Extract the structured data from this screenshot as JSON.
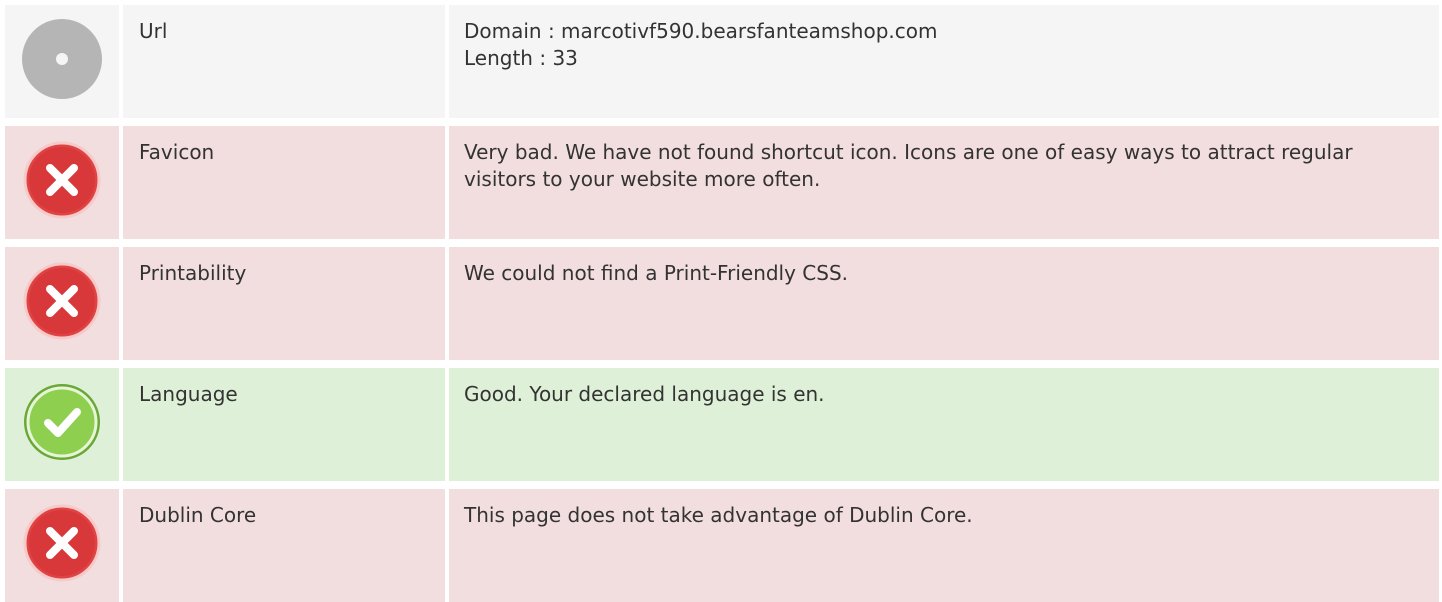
{
  "rows": [
    {
      "status": "neutral",
      "icon": "neutral-dot-icon",
      "label": "Url",
      "lines": [
        "Domain : marcotivf590.bearsfanteamshop.com",
        "Length : 33"
      ]
    },
    {
      "status": "bad",
      "icon": "error-x-icon",
      "label": "Favicon",
      "lines": [
        "Very bad. We have not found shortcut icon. Icons are one of easy ways to attract regular visitors to your website more often."
      ]
    },
    {
      "status": "bad",
      "icon": "error-x-icon",
      "label": "Printability",
      "lines": [
        "We could not find a Print-Friendly CSS."
      ]
    },
    {
      "status": "good",
      "icon": "check-icon",
      "label": "Language",
      "lines": [
        "Good. Your declared language is en."
      ]
    },
    {
      "status": "bad",
      "icon": "error-x-icon",
      "label": "Dublin Core",
      "lines": [
        "This page does not take advantage of Dublin Core."
      ]
    }
  ],
  "colors": {
    "neutral_bg": "#f5f5f5",
    "bad_bg": "#f2dede",
    "good_bg": "#dff0d8",
    "bad_icon": "#e04343",
    "good_icon": "#7cc142",
    "neutral_icon": "#b5b5b5"
  }
}
